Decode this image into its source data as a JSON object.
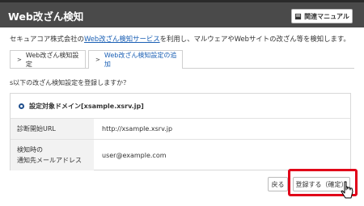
{
  "header": {
    "title": "Web改ざん検知",
    "manual_label": "関連マニュアル"
  },
  "description": {
    "prefix": "セキュアコア株式会社の",
    "link": "Web改ざん検知サービス",
    "suffix": "を利用し、マルウェアやWebサイトの改ざん等を検知します。"
  },
  "tabs": [
    {
      "label": "Web改ざん検知設定",
      "active": false
    },
    {
      "label": "Web改ざん検知設定の追加",
      "active": true
    }
  ],
  "question": "s以下の改ざん検知設定を登録しますか？",
  "panel": {
    "heading": "設定対象ドメイン[xsample.xsrv.jp]",
    "rows": [
      {
        "label": "診断開始URL",
        "value": "http://xsample.xsrv.jp"
      },
      {
        "label_line1": "検知時の",
        "label_line2": "通知先メールアドレス",
        "value": "user@example.com"
      }
    ]
  },
  "buttons": {
    "back": "戻る",
    "confirm": "登録する（確定）"
  },
  "colors": {
    "header_bg": "#4a4a4a",
    "link": "#1a5fb4",
    "highlight": "#e10019"
  },
  "icons": {
    "manual": "book-icon",
    "tab_marker": "chevron-right-icon",
    "section_marker": "radio-bullet-icon",
    "pointer": "mouse-cursor-icon"
  }
}
